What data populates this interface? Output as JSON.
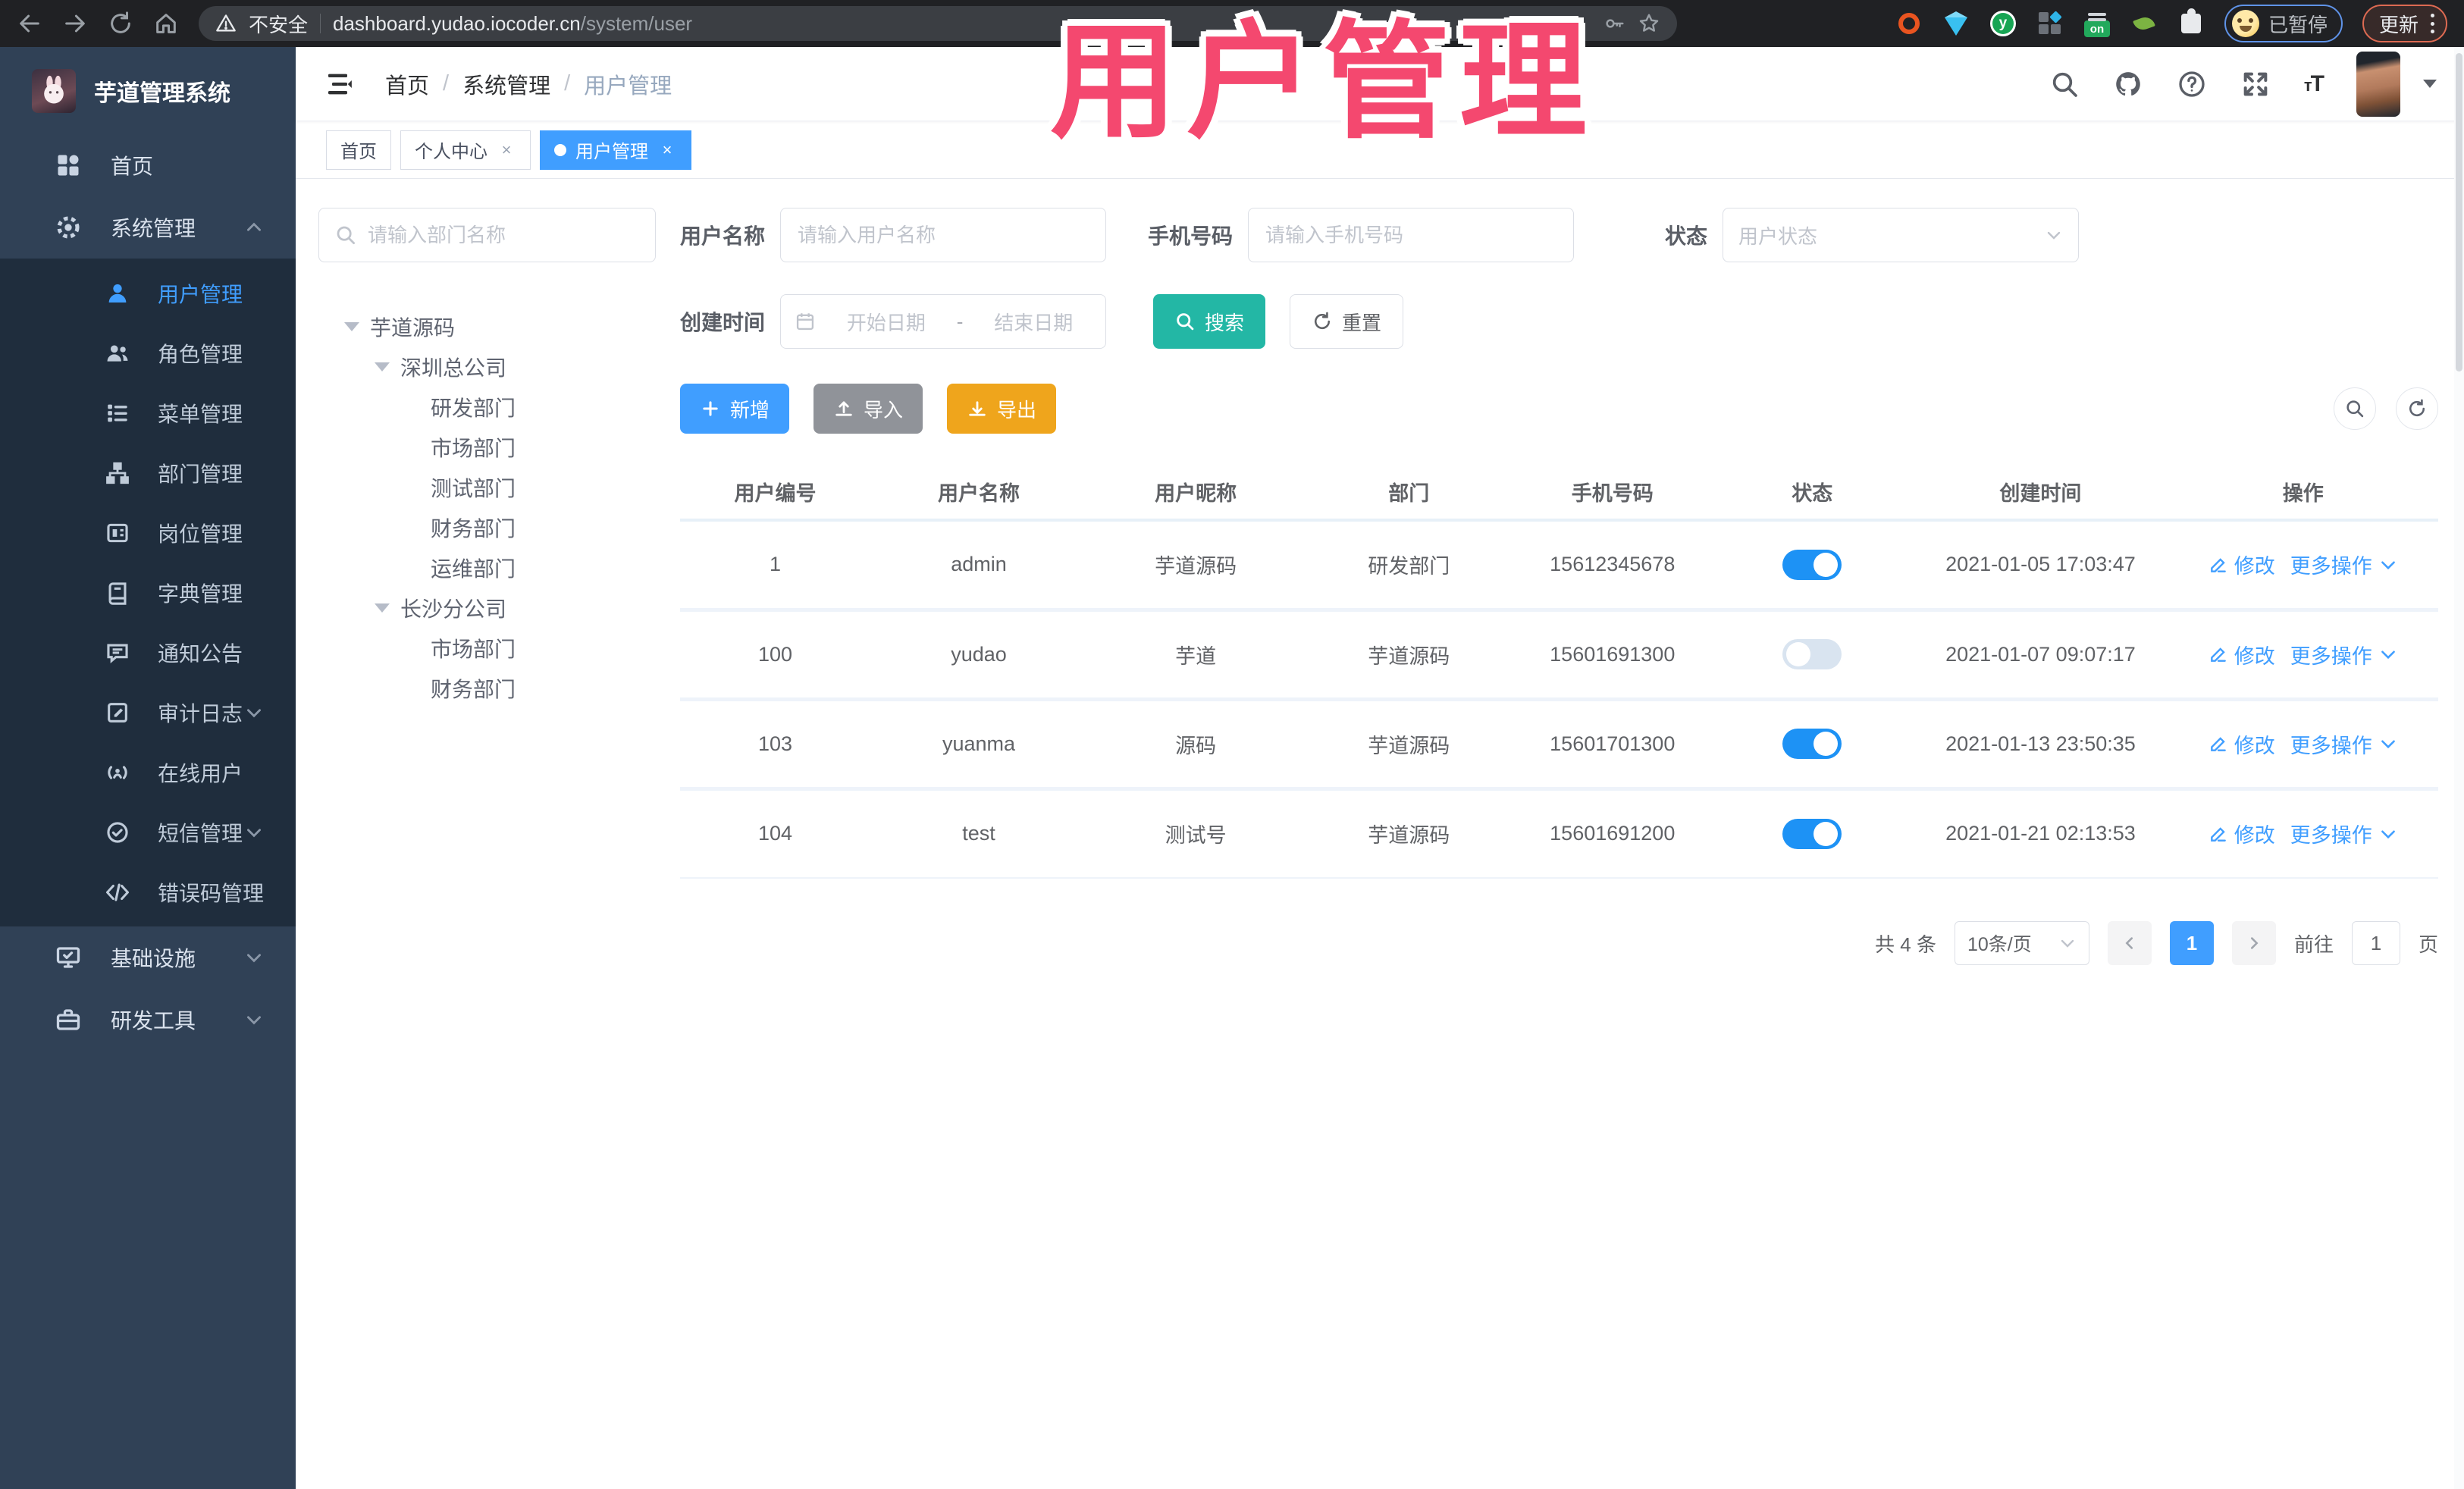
{
  "overlay_title": "用户管理",
  "browser": {
    "security_label": "不安全",
    "url_host": "dashboard.yudao.iocoder.cn",
    "url_path": "/system/user",
    "paused_label": "已暂停",
    "update_label": "更新"
  },
  "sidebar": {
    "app_title": "芋道管理系统",
    "items": [
      {
        "label": "首页",
        "icon": "dashboard-icon"
      },
      {
        "label": "系统管理",
        "icon": "gear-icon",
        "expanded": true
      },
      {
        "label": "用户管理",
        "icon": "user-icon",
        "active": true
      },
      {
        "label": "角色管理",
        "icon": "users-icon"
      },
      {
        "label": "菜单管理",
        "icon": "menu-list-icon"
      },
      {
        "label": "部门管理",
        "icon": "org-tree-icon"
      },
      {
        "label": "岗位管理",
        "icon": "post-badge-icon"
      },
      {
        "label": "字典管理",
        "icon": "dictionary-icon"
      },
      {
        "label": "通知公告",
        "icon": "announcement-icon"
      },
      {
        "label": "审计日志",
        "icon": "audit-log-icon",
        "collapsed": true
      },
      {
        "label": "在线用户",
        "icon": "online-user-icon"
      },
      {
        "label": "短信管理",
        "icon": "sms-icon",
        "collapsed": true
      },
      {
        "label": "错误码管理",
        "icon": "error-code-icon"
      },
      {
        "label": "基础设施",
        "icon": "infrastructure-icon",
        "collapsed": true
      },
      {
        "label": "研发工具",
        "icon": "dev-tools-icon",
        "collapsed": true
      }
    ]
  },
  "breadcrumb": {
    "items": [
      "首页",
      "系统管理",
      "用户管理"
    ]
  },
  "tabs": {
    "items": [
      {
        "label": "首页",
        "active": false,
        "closable": false
      },
      {
        "label": "个人中心",
        "active": false,
        "closable": true
      },
      {
        "label": "用户管理",
        "active": true,
        "closable": true
      }
    ]
  },
  "dept": {
    "search_placeholder": "请输入部门名称",
    "tree": [
      {
        "label": "芋道源码",
        "level": 0,
        "expandable": true
      },
      {
        "label": "深圳总公司",
        "level": 1,
        "expandable": true
      },
      {
        "label": "研发部门",
        "level": 2
      },
      {
        "label": "市场部门",
        "level": 2
      },
      {
        "label": "测试部门",
        "level": 2
      },
      {
        "label": "财务部门",
        "level": 2
      },
      {
        "label": "运维部门",
        "level": 2
      },
      {
        "label": "长沙分公司",
        "level": 1,
        "expandable": true
      },
      {
        "label": "市场部门",
        "level": 2
      },
      {
        "label": "财务部门",
        "level": 2
      }
    ]
  },
  "filters": {
    "username_label": "用户名称",
    "username_placeholder": "请输入用户名称",
    "mobile_label": "手机号码",
    "mobile_placeholder": "请输入手机号码",
    "status_label": "状态",
    "status_placeholder": "用户状态",
    "create_time_label": "创建时间",
    "date_start_placeholder": "开始日期",
    "date_separator": "-",
    "date_end_placeholder": "结束日期",
    "search_button": "搜索",
    "reset_button": "重置"
  },
  "toolbar": {
    "add_label": "新增",
    "import_label": "导入",
    "export_label": "导出"
  },
  "table": {
    "columns": [
      "用户编号",
      "用户名称",
      "用户昵称",
      "部门",
      "手机号码",
      "状态",
      "创建时间",
      "操作"
    ],
    "actions": {
      "edit_label": "修改",
      "more_label": "更多操作"
    },
    "rows": [
      {
        "id": "1",
        "username": "admin",
        "nickname": "芋道源码",
        "dept": "研发部门",
        "mobile": "15612345678",
        "status_on": true,
        "created": "2021-01-05 17:03:47"
      },
      {
        "id": "100",
        "username": "yudao",
        "nickname": "芋道",
        "dept": "芋道源码",
        "mobile": "15601691300",
        "status_on": false,
        "created": "2021-01-07 09:07:17"
      },
      {
        "id": "103",
        "username": "yuanma",
        "nickname": "源码",
        "dept": "芋道源码",
        "mobile": "15601701300",
        "status_on": true,
        "created": "2021-01-13 23:50:35"
      },
      {
        "id": "104",
        "username": "test",
        "nickname": "测试号",
        "dept": "芋道源码",
        "mobile": "15601691200",
        "status_on": true,
        "created": "2021-01-21 02:13:53"
      }
    ]
  },
  "pagination": {
    "total_label": "共 4 条",
    "page_size_label": "10条/页",
    "current_page": "1",
    "goto_label": "前往",
    "goto_value": "1",
    "page_unit": "页"
  }
}
